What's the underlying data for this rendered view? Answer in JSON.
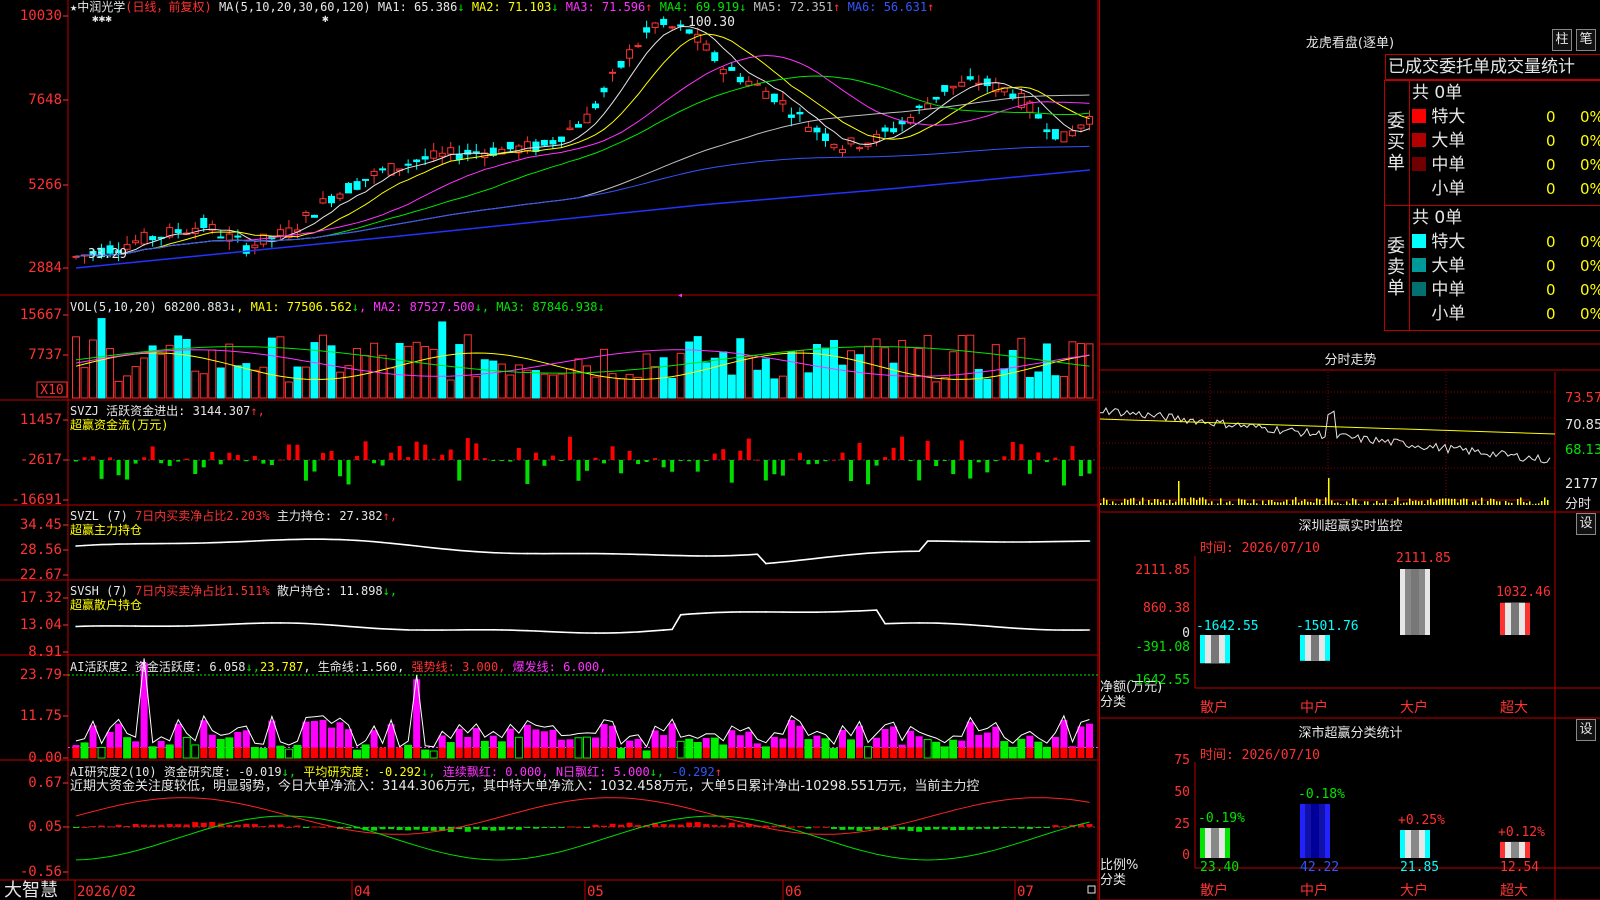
{
  "stock": {
    "star": "★",
    "name": "中润光学",
    "mode": "(日线，前复权)",
    "ma_label": "MA(5,10,20,30,60,120)",
    "ma": [
      {
        "label": "MA1:",
        "value": "65.386",
        "arrow": "↓",
        "color": "#e6e6e6"
      },
      {
        "label": "MA2:",
        "value": "71.103",
        "arrow": "↓",
        "color": "#ffff00"
      },
      {
        "label": "MA3:",
        "value": "71.596",
        "arrow": "↑",
        "color": "#ff32ff"
      },
      {
        "label": "MA4:",
        "value": "69.919",
        "arrow": "↓",
        "color": "#00e600"
      },
      {
        "label": "MA5:",
        "value": "72.351",
        "arrow": "↑",
        "color": "#c0c0c0"
      },
      {
        "label": "MA6:",
        "value": "56.631",
        "arrow": "↑",
        "color": "#3355ff"
      }
    ],
    "stars": "✱✱✱",
    "star_mid": "✱",
    "high_mark": "100.30",
    "low_mark": "33.29",
    "cursor": "◂",
    "axis": [
      "10030",
      "7648",
      "5266",
      "2884"
    ]
  },
  "volume": {
    "label": "VOL(5,10,20)",
    "value": "68200.883",
    "value_arrow": "↓",
    "ma": [
      {
        "label": "MA1:",
        "value": "77506.562",
        "arrow": "↓",
        "color": "#ffff00"
      },
      {
        "label": "MA2:",
        "value": "87527.500",
        "arrow": "↓",
        "color": "#ff32ff"
      },
      {
        "label": "MA3:",
        "value": "87846.938",
        "arrow": "↓",
        "color": "#00e600"
      }
    ],
    "axis": [
      "15667",
      "7737"
    ],
    "unit": "X10"
  },
  "svzj": {
    "label": "SVZJ",
    "title": "活跃资金进出:",
    "value": "3144.307",
    "arrow": "↑,",
    "subtitle": "超赢资金流(万元)",
    "axis": [
      "11457",
      "-2617",
      "-16691"
    ]
  },
  "svzl": {
    "label": "SVZL (7)",
    "desc": "7日内买卖净占比2.203%",
    "title": "主力持仓:",
    "value": "27.382",
    "arrow": "↑,",
    "subtitle": "超赢主力持仓",
    "axis": [
      "34.45",
      "28.56",
      "22.67"
    ]
  },
  "svsh": {
    "label": "SVSH (7)",
    "desc": "7日内买卖净占比1.511%",
    "title": "散户持仓:",
    "value": "11.898",
    "arrow": "↓,",
    "subtitle": "超赢散户持仓",
    "axis": [
      "17.32",
      "13.04",
      "8.91"
    ]
  },
  "ai_active": {
    "label": "AI活跃度2",
    "title": "资金活跃度:",
    "value": "6.058",
    "arrow": "↓,",
    "value2": "23.787",
    "life": "生命线:",
    "life_value": "1.560,",
    "strong": "强势线: 3.000,",
    "burst": "爆发线: 6.000,",
    "axis": [
      "23.79",
      "11.75",
      "0.00"
    ]
  },
  "ai_research": {
    "label": "AI研究度2(10)",
    "title": "资金研究度:",
    "value": "-0.019",
    "arrow": "↓,",
    "avg": "平均研究度: -0.292",
    "avg_arrow": "↓,",
    "red": "连续飘红: 0.000,",
    "nred": "N日飘红: 5.000",
    "nred_arrow": "↓,",
    "last": "-0.292",
    "last_arrow": "↑",
    "summary": "近期大资金关注度较低，明显弱势，今日大单净流入：3144.306万元，其中特大单净流入：1032.458万元，大单5日累计净出-10298.551万元，当前主力控",
    "axis": [
      "0.67",
      "0.05",
      "-0.56"
    ]
  },
  "xaxis": {
    "labels": [
      "2026/02",
      "04",
      "05",
      "06",
      "07"
    ],
    "brand": "大智慧"
  },
  "dragon": {
    "title": "龙虎看盘(逐单)",
    "btn1": "柱",
    "btn2": "笔",
    "header": "已成交委托单成交量统计",
    "buy_label": "委买单",
    "sell_label": "委卖单",
    "buy_total": "共 0单",
    "sell_total": "共 0单",
    "buy": [
      {
        "name": "特大",
        "count": "0",
        "pct": "0%",
        "color": "#ff0000"
      },
      {
        "name": "大单",
        "count": "0",
        "pct": "0%",
        "color": "#b00000"
      },
      {
        "name": "中单",
        "count": "0",
        "pct": "0%",
        "color": "#700000"
      },
      {
        "name": "小单",
        "count": "0",
        "pct": "0%",
        "color": "#000000"
      }
    ],
    "sell": [
      {
        "name": "特大",
        "count": "0",
        "pct": "0%",
        "color": "#00ffff"
      },
      {
        "name": "大单",
        "count": "0",
        "pct": "0%",
        "color": "#009999"
      },
      {
        "name": "中单",
        "count": "0",
        "pct": "0%",
        "color": "#007070"
      },
      {
        "name": "小单",
        "count": "0",
        "pct": "0%",
        "color": "#000000"
      }
    ]
  },
  "intraday": {
    "title": "分时走势",
    "axis": [
      "73.57",
      "70.85",
      "68.13"
    ],
    "vol": "2177",
    "vol_label": "分时"
  },
  "sz_monitor": {
    "title": "深圳超赢实时监控",
    "btn": "设",
    "time": "时间: 2026/07/10",
    "axis": [
      "2111.85",
      "860.38",
      "0",
      "-391.08",
      "-1642.55"
    ],
    "ylabel1": "净额(万元)",
    "ylabel2": "分类",
    "categories": [
      "散户",
      "中户",
      "大户",
      "超大"
    ],
    "values": [
      -1642.55,
      -1501.76,
      2111.85,
      1032.46
    ],
    "labels": [
      "-1642.55",
      "-1501.76",
      "2111.85",
      "1032.46"
    ]
  },
  "sz_class": {
    "title": "深市超赢分类统计",
    "btn": "设",
    "time": "时间: 2026/07/10",
    "axis": [
      "75",
      "50",
      "25",
      "0"
    ],
    "ylabel1": "比例%",
    "ylabel2": "分类",
    "categories": [
      "散户",
      "中户",
      "大户",
      "超大"
    ],
    "values": [
      23.4,
      42.22,
      21.85,
      12.54
    ],
    "labels": [
      "23.40",
      "42.22",
      "21.85",
      "12.54"
    ],
    "changes": [
      "-0.19%",
      "-0.18%",
      "+0.25%",
      "+0.12%"
    ]
  },
  "chart_data": [
    {
      "type": "bar",
      "title": "深圳超赢实时监控",
      "ylabel": "净额(万元)",
      "xlabel": "分类",
      "categories": [
        "散户",
        "中户",
        "大户",
        "超大"
      ],
      "values": [
        -1642.55,
        -1501.76,
        2111.85,
        1032.46
      ],
      "ylim": [
        -1642.55,
        2111.85
      ]
    },
    {
      "type": "bar",
      "title": "深市超赢分类统计",
      "ylabel": "比例%",
      "xlabel": "分类",
      "categories": [
        "散户",
        "中户",
        "大户",
        "超大"
      ],
      "values": [
        23.4,
        42.22,
        21.85,
        12.54
      ],
      "ylim": [
        0,
        75
      ]
    }
  ]
}
